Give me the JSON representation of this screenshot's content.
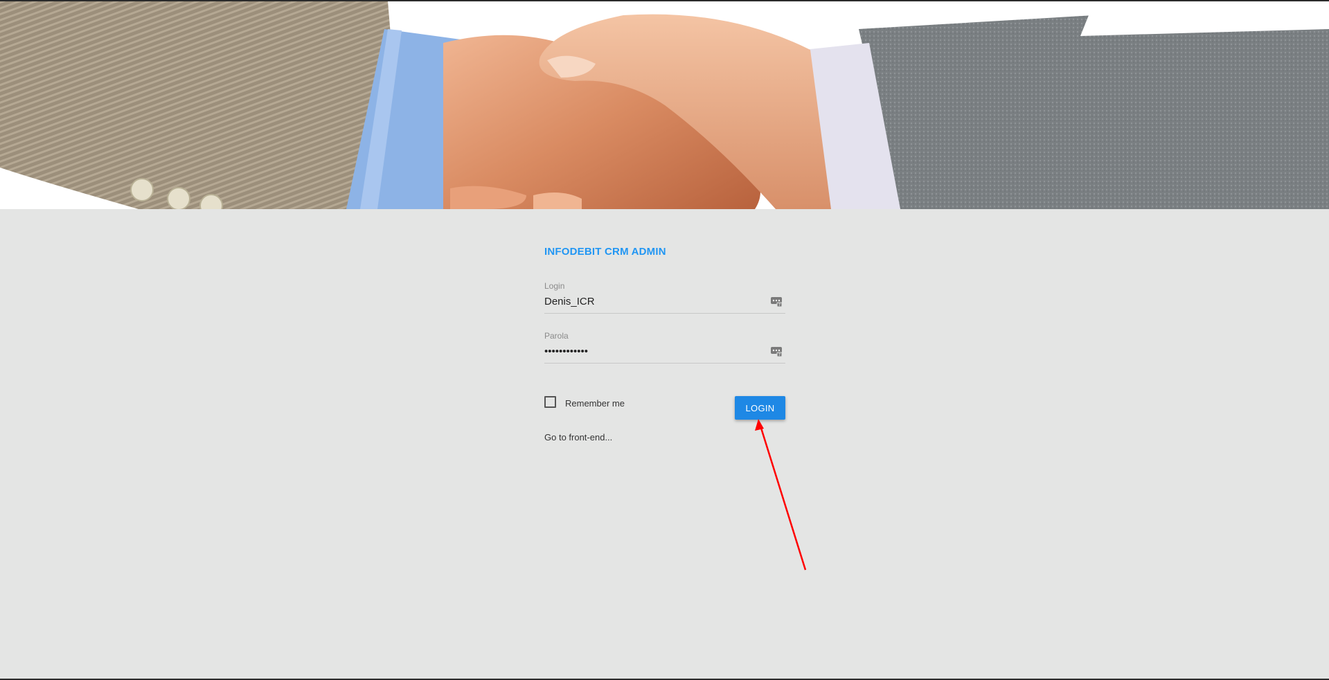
{
  "header": {
    "image": "handshake-banner",
    "accent_color": "#2196f3"
  },
  "login_form": {
    "title": "INFODEBIT CRM ADMIN",
    "login_label": "Login",
    "login_value": "Denis_ICR",
    "password_label": "Parola",
    "password_value": "••••••••••••",
    "remember_label": "Remember me",
    "remember_checked": false,
    "submit_label": "LOGIN",
    "frontend_link": "Go to front-end...",
    "field_icon": "password-manager-icon"
  },
  "annotation": {
    "type": "red-arrow",
    "color": "#ff0000",
    "target": "login-button"
  }
}
